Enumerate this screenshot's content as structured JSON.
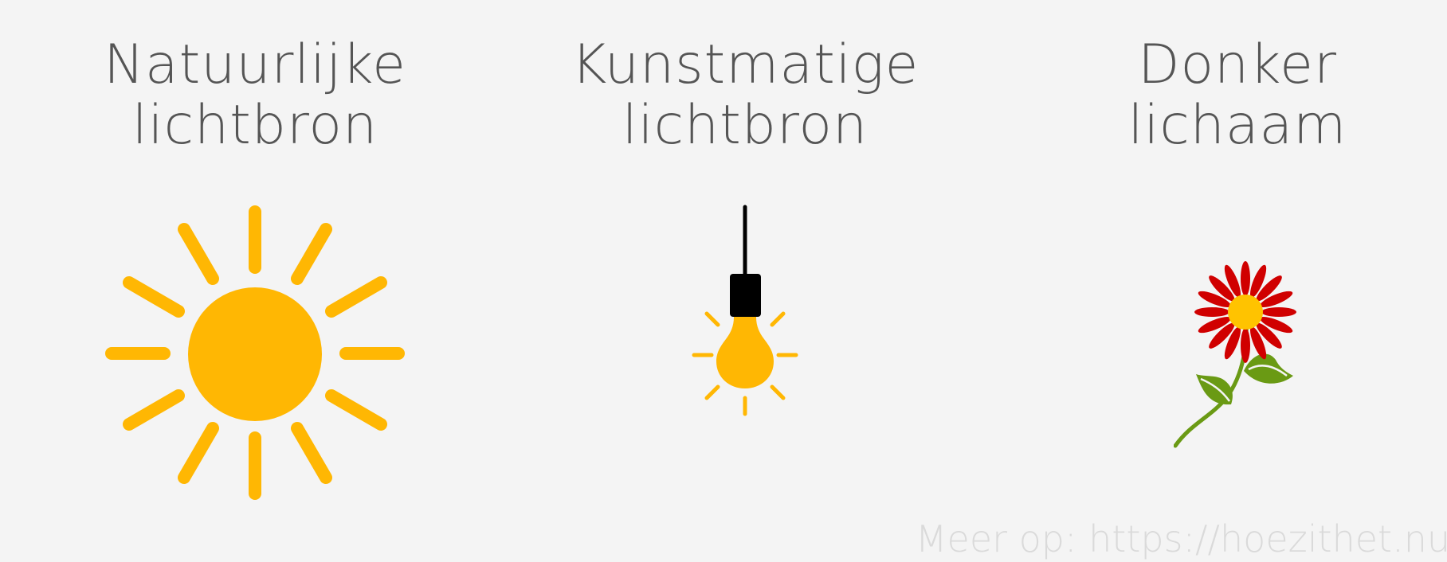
{
  "columns": [
    {
      "id": "natural",
      "title_line1": "Natuurlijke",
      "title_line2": "lichtbron",
      "icon": "sun-icon"
    },
    {
      "id": "artificial",
      "title_line1": "Kunstmatige",
      "title_line2": "lichtbron",
      "icon": "light-bulb-icon"
    },
    {
      "id": "dark",
      "title_line1": "Donker",
      "title_line2": "lichaam",
      "icon": "flower-icon"
    }
  ],
  "footer": {
    "text": "Meer op: https://hoezithet.nu"
  },
  "colors": {
    "background": "#f4f4f4",
    "text": "#555555",
    "sun": "#ffb703",
    "bulb": "#ffb703",
    "socket": "#000000",
    "petal": "#d00000",
    "flower_center": "#ffc300",
    "stem": "#6a9a14",
    "footer": "#dadada"
  }
}
